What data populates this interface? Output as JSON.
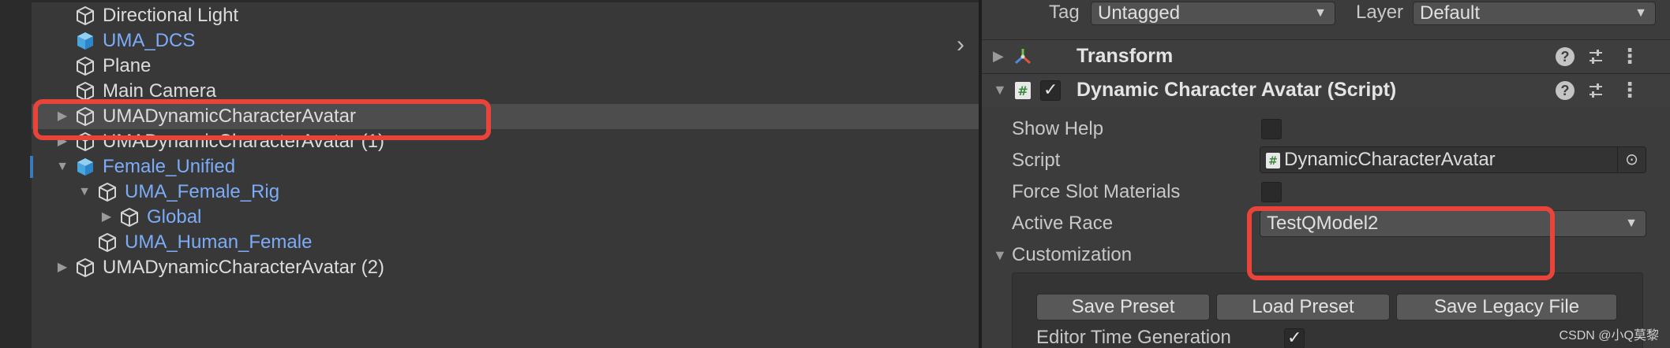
{
  "hierarchy": {
    "items": [
      {
        "label": "Directional Light",
        "color": "white"
      },
      {
        "label": "UMA_DCS",
        "color": "blue"
      },
      {
        "label": "Plane",
        "color": "white"
      },
      {
        "label": "Main Camera",
        "color": "white"
      },
      {
        "label": "UMADynamicCharacterAvatar",
        "color": "white"
      },
      {
        "label": "UMADynamicCharacterAvatar (1)",
        "color": "white"
      },
      {
        "label": "Female_Unified",
        "color": "blue"
      },
      {
        "label": "UMA_Female_Rig",
        "color": "blue"
      },
      {
        "label": "Global",
        "color": "blue"
      },
      {
        "label": "UMA_Human_Female",
        "color": "blue"
      },
      {
        "label": "UMADynamicCharacterAvatar (2)",
        "color": "white"
      }
    ]
  },
  "inspector": {
    "tag_label": "Tag",
    "tag_value": "Untagged",
    "layer_label": "Layer",
    "layer_value": "Default",
    "transform_title": "Transform",
    "script_component_title": "Dynamic Character Avatar (Script)",
    "props": {
      "show_help": "Show Help",
      "script": "Script",
      "script_value": "DynamicCharacterAvatar",
      "force_slot_materials": "Force Slot Materials",
      "active_race": "Active Race",
      "active_race_value": "TestQModel2",
      "customization": "Customization",
      "editor_time_generation": "Editor Time Generation"
    },
    "buttons": {
      "save_preset": "Save Preset",
      "load_preset": "Load Preset",
      "save_legacy_file": "Save Legacy File"
    }
  },
  "watermark": "CSDN @小Q莫黎",
  "colors": {
    "highlight": "#e8443a",
    "prefab_blue": "#7cacf8",
    "selected_row": "#4d4d4d"
  }
}
